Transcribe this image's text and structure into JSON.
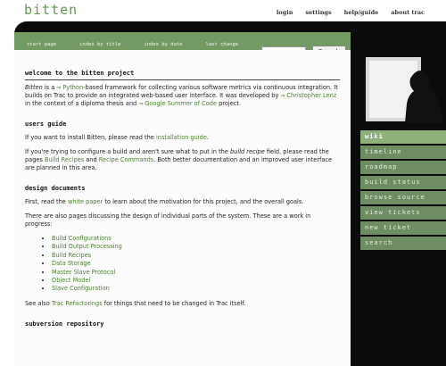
{
  "site": {
    "logo": "bitten"
  },
  "metanav": {
    "login": "login",
    "settings": "settings",
    "help": "help/guide",
    "about": "about trac"
  },
  "mainnav": {
    "start_page": "start page",
    "index_by_title": "index by title",
    "index_by_date": "index by date",
    "last_change": "last change"
  },
  "search": {
    "placeholder": "",
    "button": "Search"
  },
  "context_nav": {
    "items": [
      "wiki",
      "timeline",
      "roadmap",
      "build status",
      "browse source",
      "view tickets",
      "new ticket",
      "search"
    ]
  },
  "content": {
    "welcome": {
      "heading": "welcome to the bitten project",
      "t1": "Bitten",
      "t2": " is a ",
      "python": "Python",
      "t3": "-based framework for collecting various software metrics via continuous integration. It builds on Trac to provide an integrated web-based user interface. It was developed by ",
      "lenz": "Christopher Lenz",
      "t4": " in the context of a diploma thesis and ",
      "gsoc": "Google Summer of Code",
      "t5": " project."
    },
    "users_guide": {
      "heading": "users guide",
      "p1a": "If you want to install Bitten, please read the ",
      "p1_link": "installation guide",
      "p1b": ".",
      "p2a": "If you're trying to configure a build and aren't sure what to put in the ",
      "p2_em": "build recipe",
      "p2b": " field, please read the pages ",
      "p2_link1": "Build Recipes",
      "p2c": " and ",
      "p2_link2": "Recipe Commands",
      "p2d": ". Both better documentation and an improved user interface are planned in this area."
    },
    "design": {
      "heading": "design documents",
      "p1a": "First, read the ",
      "p1_link": "white paper",
      "p1b": " to learn about the motivation for this project, and the overall goals.",
      "p2": "There are also pages discussing the design of individual parts of the system. These are a work in progress:",
      "list": [
        "Build Configurations",
        "Build Output Processing",
        "Build Recipes",
        "Data Storage",
        "Master Slave Protocol",
        "Object Model",
        "Slave Configuration"
      ],
      "p3a": "See also ",
      "p3_link": "Trac Refactorings",
      "p3b": " for things that need to be changed in Trac itself."
    },
    "svn": {
      "heading": "subversion repository"
    }
  }
}
